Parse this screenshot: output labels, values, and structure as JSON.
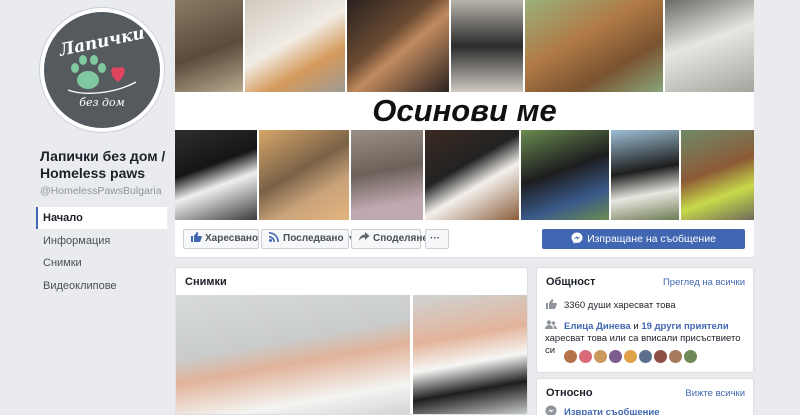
{
  "page": {
    "name": "Лапички без дом / Homeless paws",
    "handle": "@HomelessPawsBulgaria",
    "logo_text_top": "Лапички",
    "logo_text_bottom": "без дом"
  },
  "nav": {
    "items": [
      {
        "label": "Начало",
        "active": true
      },
      {
        "label": "Информация",
        "active": false
      },
      {
        "label": "Снимки",
        "active": false
      },
      {
        "label": "Видеоклипове",
        "active": false
      }
    ]
  },
  "cover": {
    "title": "Осинови ме"
  },
  "actions": {
    "like_label": "Харесвано",
    "follow_label": "Последвано",
    "share_label": "Споделяне",
    "more_label": "···",
    "message_label": "Изпращане на съобщение"
  },
  "photos": {
    "title": "Снимки"
  },
  "community": {
    "title": "Общност",
    "see_all": "Преглед на всички",
    "likes_text": "3360 души харесват това",
    "friend_name": "Елица Динева",
    "and_text": " и ",
    "others_link": "19 други приятели",
    "friends_suffix": "харесват това или са вписали присъствието си"
  },
  "about": {
    "title": "Относно",
    "see_all": "Вижте всички",
    "reply_text": "Изврати съобщение"
  },
  "colors": {
    "brand_blue": "#4267b2",
    "background": "#e9ebee"
  }
}
